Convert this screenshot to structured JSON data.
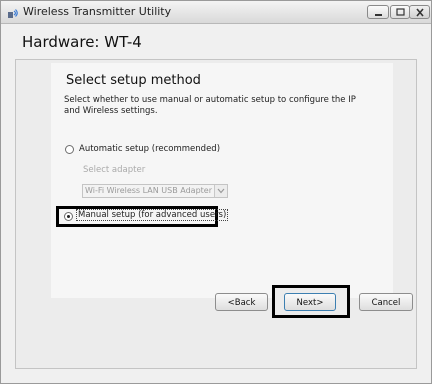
{
  "window": {
    "title": "Wireless Transmitter Utility"
  },
  "header": {
    "title": "Hardware: WT-4"
  },
  "main": {
    "section_title": "Select setup method",
    "description": "Select whether to use manual or automatic setup to configure the IP and Wireless settings.",
    "options": [
      {
        "label": "Automatic setup (recommended)",
        "selected": false
      },
      {
        "label": "Manual setup (for advanced users)",
        "selected": true
      }
    ],
    "adapter": {
      "label": "Select adapter",
      "value": "Wi-Fi Wireless LAN USB Adapter"
    }
  },
  "footer": {
    "back_label": "<Back",
    "next_label": "Next>",
    "cancel_label": "Cancel"
  },
  "colors": {
    "highlight_border": "#000000",
    "default_button_border": "#3c7fb1",
    "disabled_text": "#aaaaaa"
  }
}
